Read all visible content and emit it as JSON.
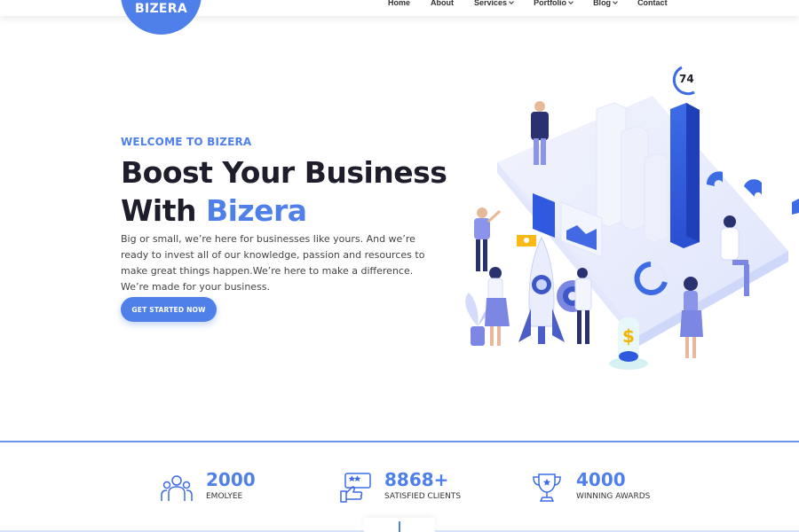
{
  "brand": {
    "logo_text": "BIZERA",
    "accent_color": "#4f80ea",
    "dark_text_color": "#1d1d2b"
  },
  "nav": {
    "items": [
      {
        "label": "Home",
        "dropdown": false
      },
      {
        "label": "About",
        "dropdown": false
      },
      {
        "label": "Services",
        "dropdown": true
      },
      {
        "label": "Portfolio",
        "dropdown": true
      },
      {
        "label": "Blog",
        "dropdown": true
      },
      {
        "label": "Contact",
        "dropdown": false
      }
    ]
  },
  "hero": {
    "welcome": "WELCOME TO BIZERA",
    "title_line1": "Boost Your Business",
    "title_line2_prefix": "With ",
    "title_line2_accent": "Bizera",
    "description": "Big or small, we’re here for businesses like yours. And we’re ready to invest all of our knowledge, passion and resources to make great things happen.We’re here to make a difference. We’re made for your business.",
    "cta_label": "GET STARTED NOW"
  },
  "illustration": {
    "gauge_value": "74",
    "icons": [
      "person-pointing-icon",
      "rocket-icon",
      "gear-icon",
      "bar-chart-icon",
      "coin-stack-icon",
      "donut-chart-icon",
      "plant-icon"
    ]
  },
  "stats": [
    {
      "value": "2000",
      "label": "EMOLYEE",
      "icon": "team-icon"
    },
    {
      "value": "8868+",
      "label": "SATISFIED CLIENTS",
      "icon": "thumbs-up-rating-icon"
    },
    {
      "value": "4000",
      "label": "WINNING AWARDS",
      "icon": "trophy-icon"
    }
  ]
}
